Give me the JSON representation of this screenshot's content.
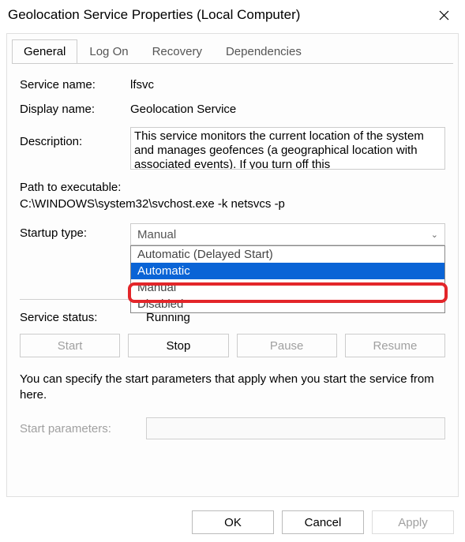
{
  "window": {
    "title": "Geolocation Service Properties (Local Computer)"
  },
  "tabs": {
    "general": "General",
    "logon": "Log On",
    "recovery": "Recovery",
    "dependencies": "Dependencies"
  },
  "fields": {
    "service_name_label": "Service name:",
    "service_name_value": "lfsvc",
    "display_name_label": "Display name:",
    "display_name_value": "Geolocation Service",
    "description_label": "Description:",
    "description_value": "This service monitors the current location of the system and manages geofences (a geographical location with associated events).  If you turn off this",
    "path_label": "Path to executable:",
    "path_value": "C:\\WINDOWS\\system32\\svchost.exe -k netsvcs -p",
    "startup_type_label": "Startup type:",
    "startup_type_value": "Manual"
  },
  "startup_options": {
    "opt0": "Automatic (Delayed Start)",
    "opt1": "Automatic",
    "opt2": "Manual",
    "opt3": "Disabled"
  },
  "status": {
    "label": "Service status:",
    "value": "Running"
  },
  "buttons": {
    "start": "Start",
    "stop": "Stop",
    "pause": "Pause",
    "resume": "Resume"
  },
  "note_text": "You can specify the start parameters that apply when you start the service from here.",
  "start_params": {
    "label": "Start parameters:"
  },
  "footer": {
    "ok": "OK",
    "cancel": "Cancel",
    "apply": "Apply"
  }
}
